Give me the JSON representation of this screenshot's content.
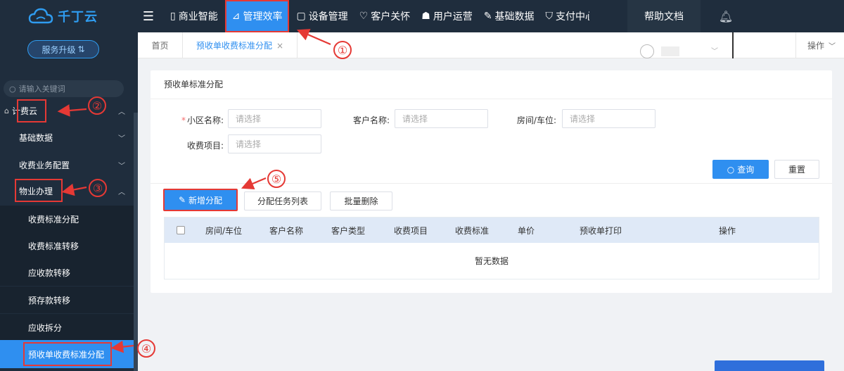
{
  "app": {
    "logo_text": "千丁云",
    "upgrade_label": "服务升级",
    "search_placeholder": "请输入关键词"
  },
  "sidebar": {
    "items": [
      {
        "label": "计费云"
      },
      {
        "label": "基础数据"
      },
      {
        "label": "收费业务配置"
      },
      {
        "label": "物业办理"
      }
    ],
    "sub_items": [
      {
        "label": "收费标准分配"
      },
      {
        "label": "收费标准转移"
      },
      {
        "label": "应收款转移"
      },
      {
        "label": "预存款转移"
      },
      {
        "label": "应收拆分"
      },
      {
        "label": "预收单收费标准分配"
      }
    ]
  },
  "topnav": {
    "items": [
      {
        "label": "商业智能"
      },
      {
        "label": "管理效率"
      },
      {
        "label": "设备管理"
      },
      {
        "label": "客户关怀"
      },
      {
        "label": "用户运营"
      },
      {
        "label": "基础数据"
      },
      {
        "label": "支付中心"
      }
    ],
    "help": "帮助文档"
  },
  "tabs": {
    "home": "首页",
    "active": "预收单收费标准分配",
    "ops": "操作"
  },
  "panel": {
    "title": "预收单标准分配",
    "fields": {
      "community": {
        "label": "小区名称:",
        "placeholder": "请选择"
      },
      "customer": {
        "label": "客户名称:",
        "placeholder": "请选择"
      },
      "room": {
        "label": "房间/车位:",
        "placeholder": "请选择"
      },
      "fee_item": {
        "label": "收费项目:",
        "placeholder": "请选择"
      }
    },
    "query_btn": "查询",
    "reset_btn": "重置",
    "add_btn": "新增分配",
    "task_list_btn": "分配任务列表",
    "batch_delete_btn": "批量删除",
    "table_headers": [
      "房间/车位",
      "客户名称",
      "客户类型",
      "收费项目",
      "收费标准",
      "单价",
      "预收单打印",
      "操作"
    ],
    "empty_text": "暂无数据"
  },
  "annotations": [
    "①",
    "②",
    "③",
    "④",
    "⑤"
  ],
  "colors": {
    "sidebar_bg": "#1f2d3d",
    "accent": "#2f8ff0",
    "annotation": "#e53935"
  }
}
